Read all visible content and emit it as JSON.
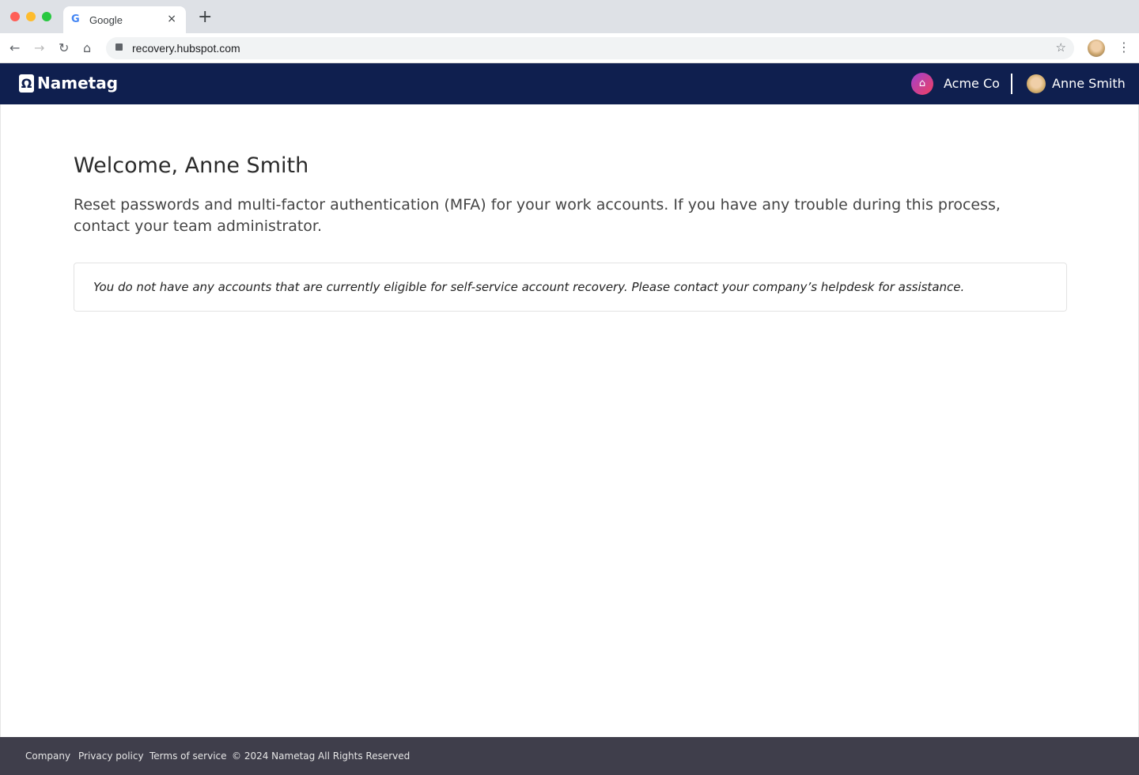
{
  "browser": {
    "tab_title": "Google",
    "url": "recovery.hubspot.com",
    "new_tab": "+",
    "close": "×"
  },
  "header": {
    "brand": "Nametag",
    "org": "Acme Co",
    "user": "Anne Smith"
  },
  "main": {
    "title": "Welcome, Anne Smith",
    "lead": "Reset passwords and multi-factor authentication (MFA) for your work accounts. If you have any trouble during this process, contact your team administrator.",
    "notice": "You do not have any accounts that are currently eligible for self-service account recovery. Please contact your company’s helpdesk for assistance."
  },
  "footer": {
    "links": [
      "Company",
      "Privacy policy",
      "Terms of service"
    ],
    "copyright": "© 2024 Nametag All Rights Reserved"
  }
}
